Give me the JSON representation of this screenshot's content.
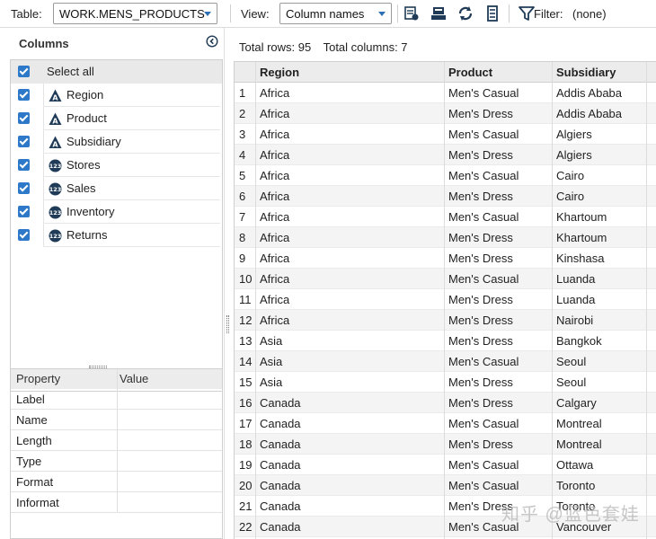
{
  "toolbar": {
    "table_label": "Table:",
    "table_value": "WORK.MENS_PRODUCTS",
    "view_label": "View:",
    "view_value": "Column names",
    "filter_label": "Filter:",
    "filter_value": "(none)",
    "icons": [
      "query-icon",
      "save-icon",
      "refresh-icon",
      "properties-icon",
      "filter-icon"
    ]
  },
  "columns_panel": {
    "title": "Columns",
    "select_all": "Select all",
    "items": [
      {
        "name": "Region",
        "type": "char"
      },
      {
        "name": "Product",
        "type": "char"
      },
      {
        "name": "Subsidiary",
        "type": "char"
      },
      {
        "name": "Stores",
        "type": "numeric"
      },
      {
        "name": "Sales",
        "type": "numeric"
      },
      {
        "name": "Inventory",
        "type": "numeric"
      },
      {
        "name": "Returns",
        "type": "numeric"
      }
    ],
    "char_glyph": "A",
    "num_glyph": "123"
  },
  "properties": {
    "col_property": "Property",
    "col_value": "Value",
    "rows": [
      "Label",
      "Name",
      "Length",
      "Type",
      "Format",
      "Informat"
    ]
  },
  "grid": {
    "total_rows": "Total rows: 95",
    "total_columns": "Total columns: 7",
    "headers": [
      "Region",
      "Product",
      "Subsidiary"
    ],
    "rows": [
      [
        "1",
        "Africa",
        "Men's Casual",
        "Addis Ababa"
      ],
      [
        "2",
        "Africa",
        "Men's Dress",
        "Addis Ababa"
      ],
      [
        "3",
        "Africa",
        "Men's Casual",
        "Algiers"
      ],
      [
        "4",
        "Africa",
        "Men's Dress",
        "Algiers"
      ],
      [
        "5",
        "Africa",
        "Men's Casual",
        "Cairo"
      ],
      [
        "6",
        "Africa",
        "Men's Dress",
        "Cairo"
      ],
      [
        "7",
        "Africa",
        "Men's Casual",
        "Khartoum"
      ],
      [
        "8",
        "Africa",
        "Men's Dress",
        "Khartoum"
      ],
      [
        "9",
        "Africa",
        "Men's Dress",
        "Kinshasa"
      ],
      [
        "10",
        "Africa",
        "Men's Casual",
        "Luanda"
      ],
      [
        "11",
        "Africa",
        "Men's Dress",
        "Luanda"
      ],
      [
        "12",
        "Africa",
        "Men's Dress",
        "Nairobi"
      ],
      [
        "13",
        "Asia",
        "Men's Dress",
        "Bangkok"
      ],
      [
        "14",
        "Asia",
        "Men's Casual",
        "Seoul"
      ],
      [
        "15",
        "Asia",
        "Men's Dress",
        "Seoul"
      ],
      [
        "16",
        "Canada",
        "Men's Dress",
        "Calgary"
      ],
      [
        "17",
        "Canada",
        "Men's Casual",
        "Montreal"
      ],
      [
        "18",
        "Canada",
        "Men's Dress",
        "Montreal"
      ],
      [
        "19",
        "Canada",
        "Men's Casual",
        "Ottawa"
      ],
      [
        "20",
        "Canada",
        "Men's Casual",
        "Toronto"
      ],
      [
        "21",
        "Canada",
        "Men's Dress",
        "Toronto"
      ],
      [
        "22",
        "Canada",
        "Men's Casual",
        "Vancouver"
      ]
    ]
  },
  "watermark": "知乎 @蓝色套娃",
  "colors": {
    "accent": "#2d78c8",
    "icon_dark": "#1f3b57"
  }
}
